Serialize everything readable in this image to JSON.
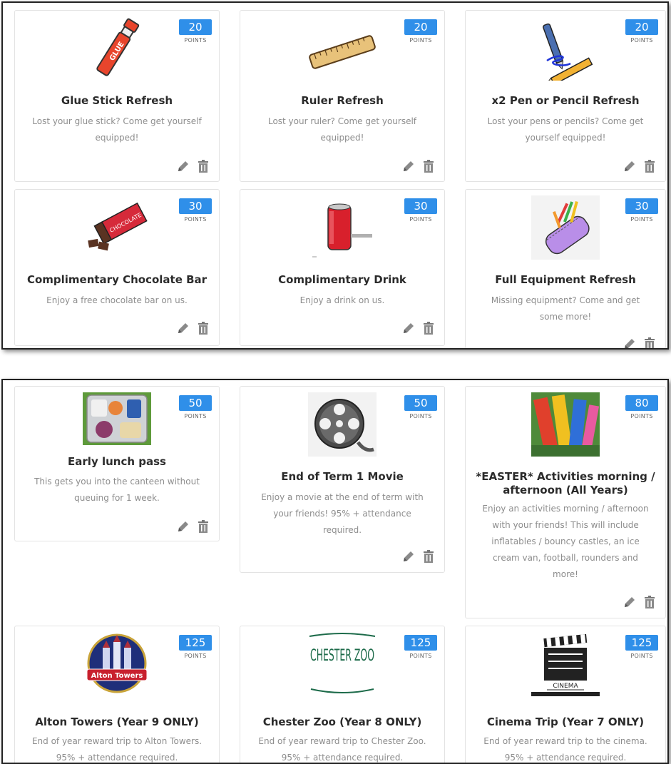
{
  "badge_label": "POINTS",
  "colors": {
    "badge": "#2f8fe9",
    "title": "#2b2b2b",
    "description": "#8d8d8d",
    "card_border": "#e3e3e3"
  },
  "panels": [
    {
      "rewards": [
        {
          "points": "20",
          "image": "glue-stick-image",
          "title": "Glue Stick Refresh",
          "description": "Lost your glue stick? Come get yourself equipped!"
        },
        {
          "points": "20",
          "image": "ruler-image",
          "title": "Ruler Refresh",
          "description": "Lost your ruler? Come get yourself equipped!"
        },
        {
          "points": "20",
          "image": "pen-pencil-image",
          "title": "x2 Pen or Pencil Refresh",
          "description": "Lost your pens or pencils? Come get yourself equipped!"
        },
        {
          "points": "30",
          "image": "chocolate-bar-image",
          "title": "Complimentary Chocolate Bar",
          "description": "Enjoy a free chocolate bar on us.",
          "image_text": "CHOCOLATE"
        },
        {
          "points": "30",
          "image": "drink-can-image",
          "title": "Complimentary Drink",
          "description": "Enjoy a drink on us."
        },
        {
          "points": "30",
          "image": "pencil-case-image",
          "title": "Full Equipment Refresh",
          "description": "Missing equipment? Come and get some more!"
        }
      ]
    },
    {
      "rewards": [
        {
          "points": "50",
          "image": "lunch-tray-image",
          "title": "Early lunch pass",
          "description": "This gets you into the canteen without queuing for 1 week."
        },
        {
          "points": "50",
          "image": "film-reel-image",
          "title": "End of Term 1 Movie",
          "description": "Enjoy a movie at the end of term with your friends! 95% + attendance required."
        },
        {
          "points": "80",
          "image": "inflatables-image",
          "title": "*EASTER* Activities morning / afternoon (All Years)",
          "description": "Enjoy an activities morning / afternoon with your friends! This will include inflatables / bouncy castles, an ice cream van, football, rounders and more!"
        },
        {
          "points": "125",
          "image": "alton-towers-logo",
          "title": "Alton Towers (Year 9 ONLY)",
          "description": "End of year reward trip to Alton Towers. 95% + attendance required.",
          "image_text": "Alton Towers"
        },
        {
          "points": "125",
          "image": "chester-zoo-logo",
          "title": "Chester Zoo (Year 8 ONLY)",
          "description": "End of year reward trip to Chester Zoo. 95% + attendance required.",
          "image_text": "CHESTER ZOO"
        },
        {
          "points": "125",
          "image": "cinema-clapperboard-image",
          "title": "Cinema Trip (Year 7 ONLY)",
          "description": "End of year reward trip to the cinema. 95% + attendance required.",
          "image_text": "CINEMA"
        }
      ]
    }
  ]
}
